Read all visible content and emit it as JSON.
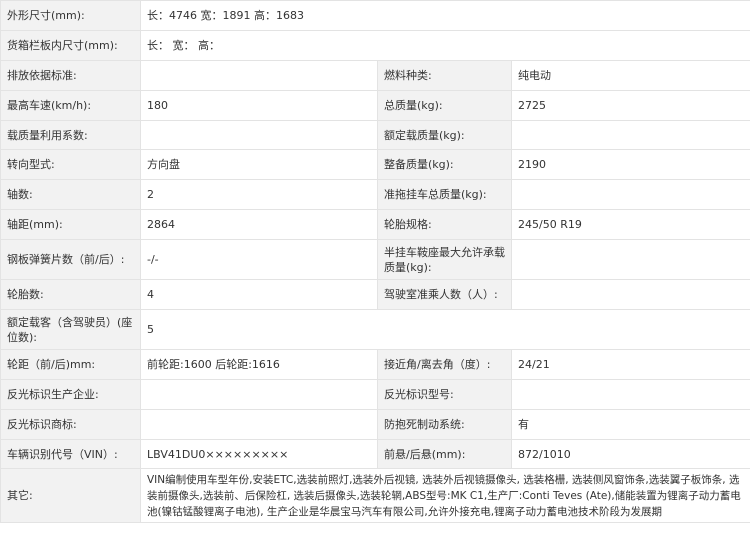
{
  "rows": [
    {
      "l1": "外形尺寸(mm):",
      "v1": "长：4746 宽：1891 高：1683",
      "full": true
    },
    {
      "l1": "货箱栏板内尺寸(mm):",
      "v1": "长：  宽：  高：",
      "full": true
    },
    {
      "l1": "排放依据标准:",
      "v1": "",
      "l2": "燃料种类:",
      "v2": "纯电动"
    },
    {
      "l1": "最高车速(km/h):",
      "v1": "180",
      "l2": "总质量(kg):",
      "v2": "2725"
    },
    {
      "l1": "载质量利用系数:",
      "v1": "",
      "l2": "额定载质量(kg):",
      "v2": ""
    },
    {
      "l1": "转向型式:",
      "v1": "方向盘",
      "l2": "整备质量(kg):",
      "v2": "2190"
    },
    {
      "l1": "轴数:",
      "v1": "2",
      "l2": "准拖挂车总质量(kg):",
      "v2": ""
    },
    {
      "l1": "轴距(mm):",
      "v1": "2864",
      "l2": "轮胎规格:",
      "v2": "245/50 R19"
    },
    {
      "l1": "钢板弹簧片数（前/后）:",
      "v1": "-/-",
      "l2": "半挂车鞍座最大允许承载质量(kg):",
      "v2": ""
    },
    {
      "l1": "轮胎数:",
      "v1": "4",
      "l2": "驾驶室准乘人数（人）:",
      "v2": ""
    },
    {
      "l1": "额定载客（含驾驶员）(座位数):",
      "v1": "5",
      "full": true
    },
    {
      "l1": "轮距（前/后)mm:",
      "v1": "前轮距:1600 后轮距:1616",
      "l2": "接近角/离去角（度）:",
      "v2": "24/21"
    },
    {
      "l1": "反光标识生产企业:",
      "v1": "",
      "l2": "反光标识型号:",
      "v2": ""
    },
    {
      "l1": "反光标识商标:",
      "v1": "",
      "l2": "防抱死制动系统:",
      "v2": "有"
    },
    {
      "l1": "车辆识别代号（VIN）:",
      "v1": "LBV41DU0×××××××××",
      "l2": "前悬/后悬(mm):",
      "v2": "872/1010"
    }
  ],
  "notes": {
    "label": "其它:",
    "text": "VIN编制使用车型年份,安装ETC,选装前照灯,选装外后视镜, 选装外后视镜摄像头, 选装格栅, 选装侧风窗饰条,选装翼子板饰条, 选装前摄像头,选装前、后保险杠, 选装后摄像头,选装轮辋,ABS型号:MK C1,生产厂:Conti Teves (Ate),储能装置为锂离子动力蓄电池(镍钴锰酸锂离子电池), 生产企业是华晨宝马汽车有限公司,允许外接充电,锂离子动力蓄电池技术阶段为发展期"
  }
}
